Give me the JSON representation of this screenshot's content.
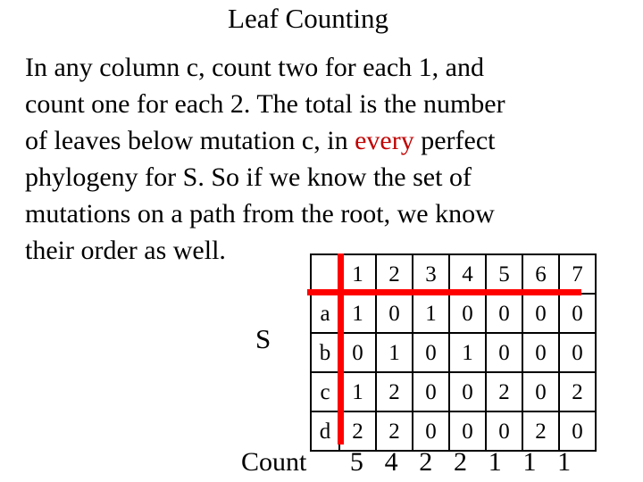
{
  "slide": {
    "title": "Leaf Counting",
    "body_lines": [
      [
        {
          "text": "In any column c, count two for each 1, and",
          "color": "black"
        }
      ],
      [
        {
          "text": "count one for each 2.  The total is the number",
          "color": "black"
        }
      ],
      [
        {
          "text": "of leaves below mutation c, in ",
          "color": "black"
        },
        {
          "text": "every",
          "color": "red"
        },
        {
          "text": " perfect",
          "color": "black"
        }
      ],
      [
        {
          "text": "phylogeny for S. So if we know the set of",
          "color": "black"
        }
      ],
      [
        {
          "text": "mutations on a path from the root, we know",
          "color": "black"
        }
      ],
      [
        {
          "text": "their order as well.",
          "color": "black"
        }
      ]
    ],
    "set_label": "S",
    "count_label": "Count",
    "colors": {
      "highlight_text_red": "#c00000",
      "guide_line_red": "#ff0000",
      "table_border": "#000000",
      "background": "#ffffff"
    }
  },
  "matrix": {
    "corner_label": "",
    "column_headers": [
      "1",
      "2",
      "3",
      "4",
      "5",
      "6",
      "7"
    ],
    "rows": [
      {
        "label": "a",
        "values": [
          "1",
          "0",
          "1",
          "0",
          "0",
          "0",
          "0"
        ]
      },
      {
        "label": "b",
        "values": [
          "0",
          "1",
          "0",
          "1",
          "0",
          "0",
          "0"
        ]
      },
      {
        "label": "c",
        "values": [
          "1",
          "2",
          "0",
          "0",
          "2",
          "0",
          "2"
        ]
      },
      {
        "label": "d",
        "values": [
          "2",
          "2",
          "0",
          "0",
          "0",
          "2",
          "0"
        ]
      }
    ],
    "counts": [
      "5",
      "4",
      "2",
      "2",
      "1",
      "1",
      "1"
    ]
  }
}
